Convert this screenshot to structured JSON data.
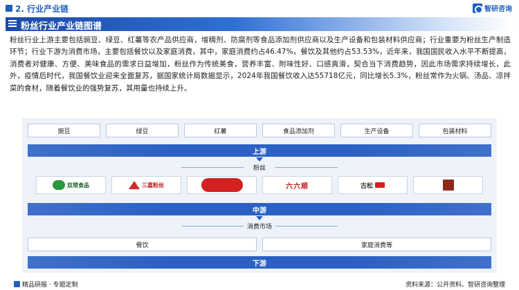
{
  "header": {
    "section_title": "2. 行业产业链",
    "brand_name": "智研咨询"
  },
  "title_bar": {
    "title": "粉丝行业产业链图谱"
  },
  "paragraph": "粉丝行业上游主要包括豌豆、绿豆、红薯等农产品供应商，增稠剂、防腐剂等食品添加剂供应商以及生产设备和包装材料供应商；行业重要为粉丝生产制造环节；行业下游为消费市场，主要包括餐饮以及家庭消费，其中，家庭消费约占46.47%，餐饮及其他约占53.53%，近年来，我国国民收入水平不断提高，消费者对健康、方便、美味食品的需求日益增加，粉丝作为传统美食，营养丰富、附味性好、口感爽滑，契合当下消费趋势，因此市场需求持续增长，此外，疫情后时代，我国餐饮业迎来全面复苏，据国家统计局数据显示，2024年我国餐饮收入达55718亿元，同比增长5.3%，粉丝常作为火锅、汤品、凉拌菜的食材，随着餐饮业的强势复苏，其用量也持续上升。",
  "diagram": {
    "upstream": {
      "items": [
        "豌豆",
        "绿豆",
        "红薯",
        "食品添加剂",
        "生产设备",
        "包装材料"
      ],
      "band_label": "上游"
    },
    "midstream": {
      "label": "粉丝",
      "band_label": "中游",
      "logos": [
        {
          "name": "双塔食品",
          "icon": "double-tower-logo"
        },
        {
          "name": "三嘉粉丝",
          "icon": "sanjia-logo"
        },
        {
          "name": "",
          "icon": "red-brand-logo"
        },
        {
          "name": "六六顺",
          "icon": "liuliushun-logo"
        },
        {
          "name": "古松",
          "icon": "gusong-logo"
        },
        {
          "name": "",
          "icon": "heritage-brand-logo"
        }
      ]
    },
    "downstream": {
      "label": "消费市场",
      "items": [
        "餐饮",
        "家庭消费等"
      ],
      "band_label": "下游"
    }
  },
  "footer": {
    "left": "精品研报 · 专题定制",
    "right": "资料来源：公开资料、智研咨询整理"
  },
  "colors": {
    "accent": "#1f5fbf",
    "diagram_bg": "#eef3fa"
  }
}
